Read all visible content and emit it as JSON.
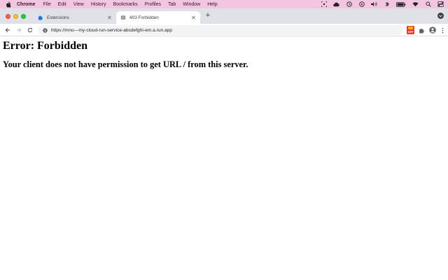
{
  "menubar": {
    "app_name": "Chrome",
    "items": [
      "File",
      "Edit",
      "View",
      "History",
      "Bookmarks",
      "Profiles",
      "Tab",
      "Window",
      "Help"
    ],
    "status_icons": [
      "screen-capture-icon",
      "creative-cloud-icon",
      "clock-icon",
      "play-icon",
      "volume-icon",
      "bluetooth-icon",
      "battery-icon",
      "wifi-icon",
      "search-icon",
      "control-center-icon"
    ]
  },
  "tabs": [
    {
      "title": "Extensions",
      "icon": "puzzle-icon",
      "active": false
    },
    {
      "title": "403 Forbidden",
      "icon": "globe-icon",
      "active": true
    }
  ],
  "toolbar": {
    "url": "https://mno---my-cloud-run-service-abcdefghi-em.a.run.app",
    "extension_badge": "OFF"
  },
  "page": {
    "heading": "Error: Forbidden",
    "message": "Your client does not have permission to get URL / from this server."
  },
  "colors": {
    "menubar_bg": "#f2c6df",
    "tabstrip_bg": "#dee1e6",
    "omnibox_bg": "#f1f3f4"
  }
}
